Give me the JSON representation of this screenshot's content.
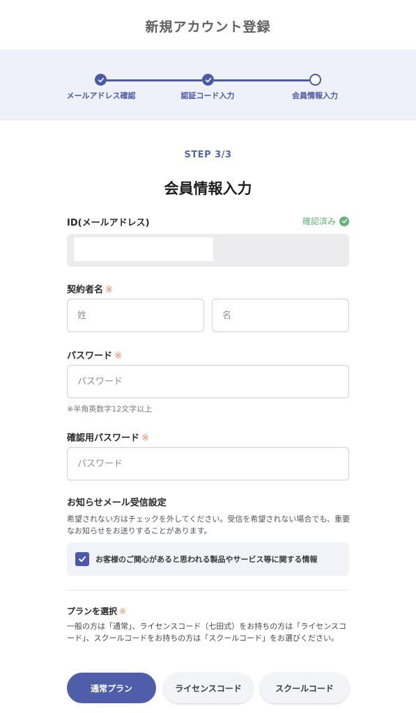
{
  "header": {
    "title": "新規アカウント登録"
  },
  "stepper": {
    "steps": [
      {
        "label": "メールアドレス確認",
        "status": "done"
      },
      {
        "label": "認証コード入力",
        "status": "done"
      },
      {
        "label": "会員情報入力",
        "status": "current"
      }
    ]
  },
  "step_count": "STEP 3/3",
  "section_title": "会員情報入力",
  "id_field": {
    "label": "ID(メールアドレス)",
    "status": "確認済み",
    "value": ""
  },
  "name_field": {
    "label": "契約者名",
    "required_mark": "※",
    "last_placeholder": "姓",
    "first_placeholder": "名"
  },
  "password_field": {
    "label": "パスワード",
    "required_mark": "※",
    "placeholder": "パスワード",
    "hint": "※半角英数字12文字以上"
  },
  "confirm_password_field": {
    "label": "確認用パスワード",
    "required_mark": "※",
    "placeholder": "パスワード"
  },
  "notification": {
    "title": "お知らせメール受信設定",
    "description": "希望されない方はチェックを外してください。受信を希望されない場合でも、重要なお知らせをお送りすることがあります。",
    "option_label": "お客様のご関心があると思われる製品やサービス等に関する情報",
    "checked": true
  },
  "plan": {
    "title": "プランを選択",
    "required_mark": "※",
    "description": "一般の方は「通常」、ライセンスコード（七田式）をお持ちの方は「ライセンスコード」、スクールコードをお持ちの方は「スクールコード」をお選びください。",
    "options": [
      "通常プラン",
      "ライセンスコード",
      "スクールコード"
    ],
    "selected": "通常プラン"
  },
  "colors": {
    "accent": "#4a5aa8",
    "verified": "#62b27a",
    "required": "#f08a5d",
    "band": "#eef1f8"
  },
  "icons": {
    "step_done": "check-icon",
    "verified": "check-circle-icon",
    "checkbox": "checkbox-checked-icon"
  }
}
